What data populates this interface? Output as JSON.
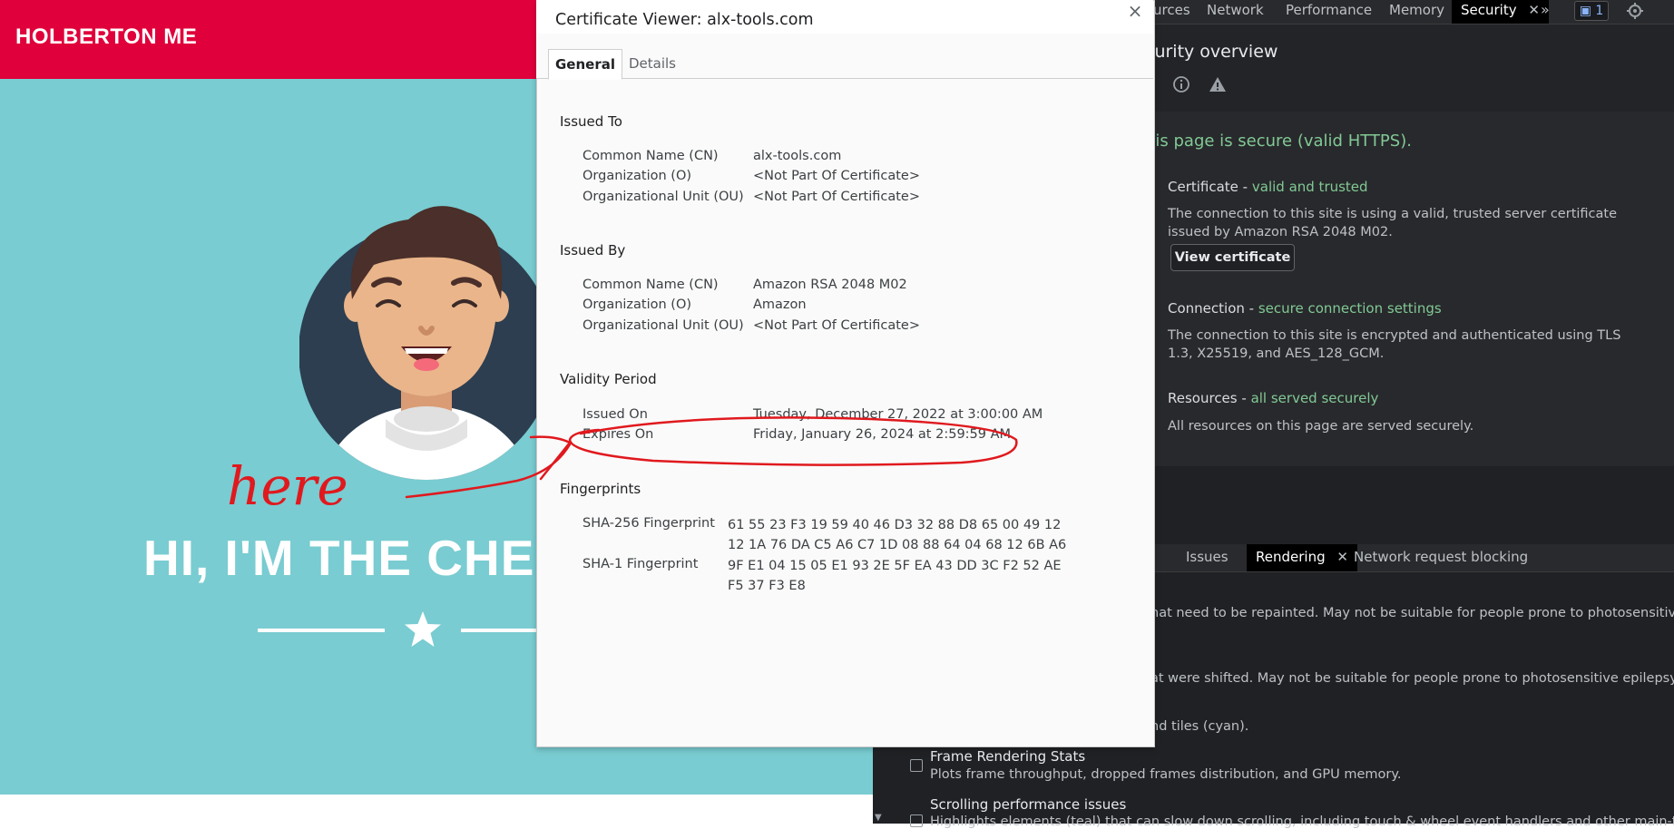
{
  "website": {
    "logo": "HOLBERTON ME",
    "hero_title": "HI, I'M THE CHE"
  },
  "devtools": {
    "tabs": [
      "urces",
      "Network",
      "Performance",
      "Memory"
    ],
    "active_tab": "Security",
    "issues_count": "1",
    "overview_title": "curity overview",
    "secure_message": "his page is secure (valid HTTPS).",
    "certificate": {
      "head": "Certificate - ",
      "status": "valid and trusted",
      "text": "The connection to this site is using a valid, trusted server certificate issued by Amazon RSA 2048 M02.",
      "button": "View certificate"
    },
    "connection": {
      "head": "Connection - ",
      "status": "secure connection settings",
      "text": "The connection to this site is encrypted and authenticated using TLS 1.3, X25519, and AES_128_GCM."
    },
    "resources": {
      "head": "Resources - ",
      "status": "all served securely",
      "text": "All resources on this page are served securely."
    },
    "drawer_tabs": {
      "issues": "Issues",
      "rendering": "Rendering",
      "network_blocking": "Network request blocking"
    },
    "rendering": {
      "line1": "hat need to be repainted. May not be suitable for people prone to photosensitive",
      "line2": "at were shifted. May not be suitable for people prone to photosensitive epilepsy.",
      "line3": "nd tiles (cyan).",
      "frame_stats_head": "Frame Rendering Stats",
      "frame_stats_text": "Plots frame throughput, dropped frames distribution, and GPU memory.",
      "scroll_head": "Scrolling performance issues",
      "scroll_text": "Highlights elements (teal) that can slow down scrolling, including touch & wheel event handlers and other main-thread"
    }
  },
  "dialog": {
    "title": "Certificate Viewer: alx-tools.com",
    "tabs": {
      "general": "General",
      "details": "Details"
    },
    "close": "×",
    "issued_to": {
      "heading": "Issued To",
      "cn_label": "Common Name (CN)",
      "cn": "alx-tools.com",
      "o_label": "Organization (O)",
      "o": "<Not Part Of Certificate>",
      "ou_label": "Organizational Unit (OU)",
      "ou": "<Not Part Of Certificate>"
    },
    "issued_by": {
      "heading": "Issued By",
      "cn_label": "Common Name (CN)",
      "cn": "Amazon RSA 2048 M02",
      "o_label": "Organization (O)",
      "o": "Amazon",
      "ou_label": "Organizational Unit (OU)",
      "ou": "<Not Part Of Certificate>"
    },
    "validity": {
      "heading": "Validity Period",
      "issued_label": "Issued On",
      "issued": "Tuesday, December 27, 2022 at 3:00:00 AM",
      "expires_label": "Expires On",
      "expires": "Friday, January 26, 2024 at 2:59:59 AM"
    },
    "fingerprints": {
      "heading": "Fingerprints",
      "sha256_label": "SHA-256 Fingerprint",
      "sha256_line1": "61 55 23 F3 19 59 40 46 D3 32 88 D8 65 00 49 12",
      "sha256_line2": "12 1A 76 DA C5 A6 C7 1D 08 88 64 04 68 12 6B A6",
      "sha1_label": "SHA-1 Fingerprint",
      "sha1_line1": "9F E1 04 15 05 E1 93 2E 5F EA 43 DD 3C F2 52 AE",
      "sha1_line2": "F5 37 F3 E8"
    }
  },
  "annotation": {
    "text": "here",
    "color": "#e0191e"
  }
}
